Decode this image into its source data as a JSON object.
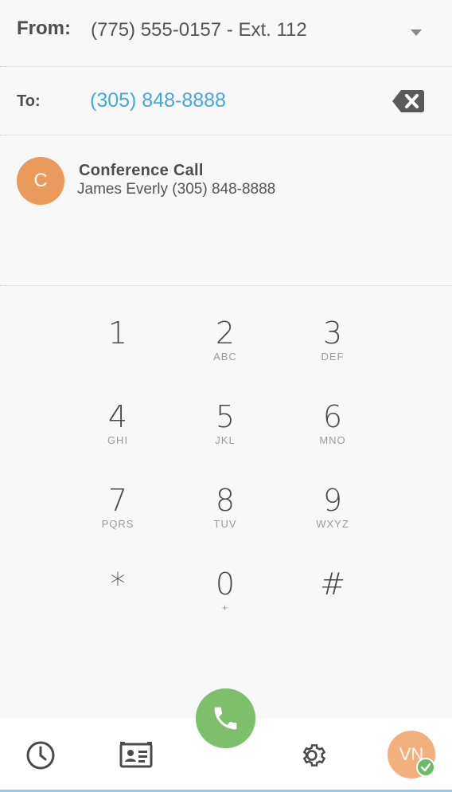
{
  "from": {
    "label": "From:",
    "value": "(775) 555-0157 - Ext. 112"
  },
  "to": {
    "label": "To:",
    "value": "(305) 848-8888"
  },
  "contact": {
    "initial": "C",
    "name": "Conference Call",
    "detail": "James Everly (305) 848-8888"
  },
  "keypad": [
    {
      "digit": "1",
      "letters": ""
    },
    {
      "digit": "2",
      "letters": "ABC"
    },
    {
      "digit": "3",
      "letters": "DEF"
    },
    {
      "digit": "4",
      "letters": "GHI"
    },
    {
      "digit": "5",
      "letters": "JKL"
    },
    {
      "digit": "6",
      "letters": "MNO"
    },
    {
      "digit": "7",
      "letters": "PQRS"
    },
    {
      "digit": "8",
      "letters": "TUV"
    },
    {
      "digit": "9",
      "letters": "WXYZ"
    },
    {
      "digit": "*",
      "letters": ""
    },
    {
      "digit": "0",
      "letters": "+"
    },
    {
      "digit": "#",
      "letters": ""
    }
  ],
  "user": {
    "initials": "VN",
    "status": "online"
  },
  "icons": {
    "dropdown": "caret-down-icon",
    "backspace": "backspace-icon",
    "call": "phone-icon",
    "history": "clock-icon",
    "contacts": "contact-card-icon",
    "settings": "gear-icon",
    "status": "check-icon"
  },
  "colors": {
    "accent": "#3fa9e6",
    "call": "#7dbf6a",
    "contact_avatar": "#eb9a5c",
    "user_avatar": "#f2b07f",
    "online": "#6cbb6a"
  }
}
